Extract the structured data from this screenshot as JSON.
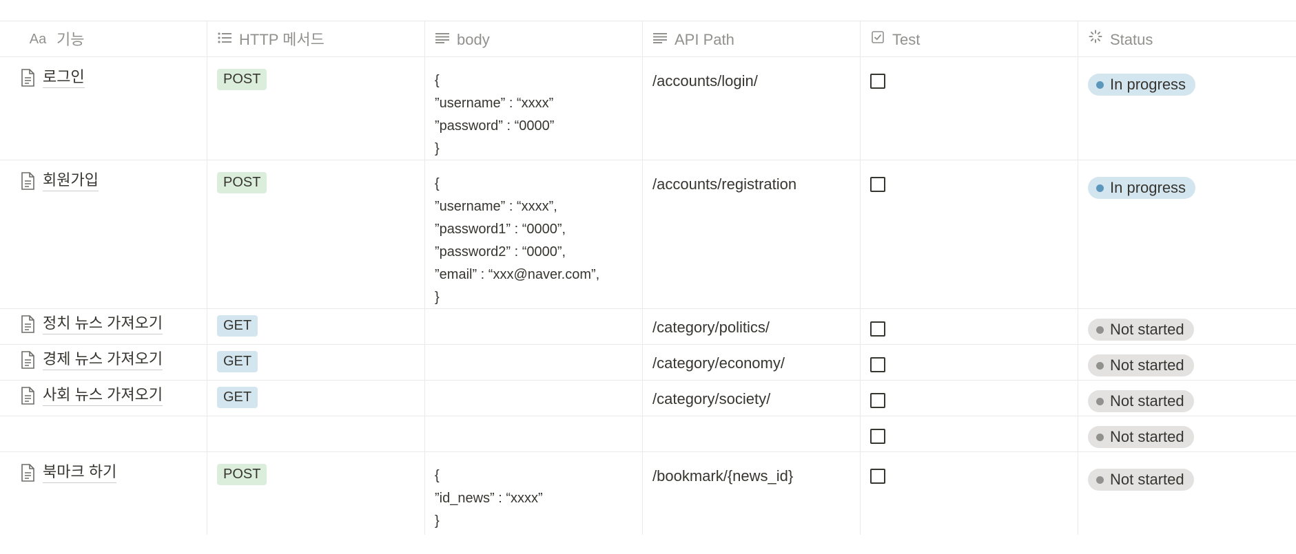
{
  "columns": [
    {
      "label": "기능",
      "icon": "title-aa-icon",
      "prefix": "Aa"
    },
    {
      "label": "HTTP 메서드",
      "icon": "multiselect-list-icon"
    },
    {
      "label": "body",
      "icon": "text-lines-icon"
    },
    {
      "label": "API Path",
      "icon": "text-lines-icon"
    },
    {
      "label": "Test",
      "icon": "checkbox-icon"
    },
    {
      "label": "Status",
      "icon": "status-spinner-icon"
    }
  ],
  "rows": [
    {
      "title": "로그인",
      "method": "POST",
      "method_color": "green",
      "body": "{\n”username” : “xxxx”\n”password” : “0000”\n}",
      "path": "/accounts/login/",
      "test": false,
      "status": "In progress",
      "status_kind": "progress"
    },
    {
      "title": "회원가입",
      "method": "POST",
      "method_color": "green",
      "body": "{\n”username” : “xxxx”,\n”password1” : “0000”,\n”password2” : “0000”,\n”email” : “xxx@naver.com”,\n}",
      "path": "/accounts/registration",
      "test": false,
      "status": "In progress",
      "status_kind": "progress"
    },
    {
      "title": "정치 뉴스 가져오기",
      "method": "GET",
      "method_color": "blue",
      "body": "",
      "path": "/category/politics/",
      "test": false,
      "status": "Not started",
      "status_kind": "notstarted"
    },
    {
      "title": "경제 뉴스 가져오기",
      "method": "GET",
      "method_color": "blue",
      "body": "",
      "path": "/category/economy/",
      "test": false,
      "status": "Not started",
      "status_kind": "notstarted"
    },
    {
      "title": "사회 뉴스 가져오기",
      "method": "GET",
      "method_color": "blue",
      "body": "",
      "path": "/category/society/",
      "test": false,
      "status": "Not started",
      "status_kind": "notstarted"
    },
    {
      "title": "",
      "method": "",
      "method_color": "",
      "body": "",
      "path": "",
      "test": false,
      "status": "Not started",
      "status_kind": "notstarted"
    },
    {
      "title": "북마크 하기",
      "method": "POST",
      "method_color": "green",
      "body": "{\n”id_news” : “xxxx”\n}",
      "path": "/bookmark/{news_id}",
      "test": false,
      "status": "Not started",
      "status_kind": "notstarted"
    }
  ],
  "colors": {
    "post_tag": "#dbeddb",
    "get_tag": "#d3e5ef",
    "in_progress": "#d3e5ef",
    "not_started": "#e3e2e0",
    "in_progress_dot": "#5b97bd",
    "not_started_dot": "#91918e",
    "border": "#e9e9e7"
  }
}
